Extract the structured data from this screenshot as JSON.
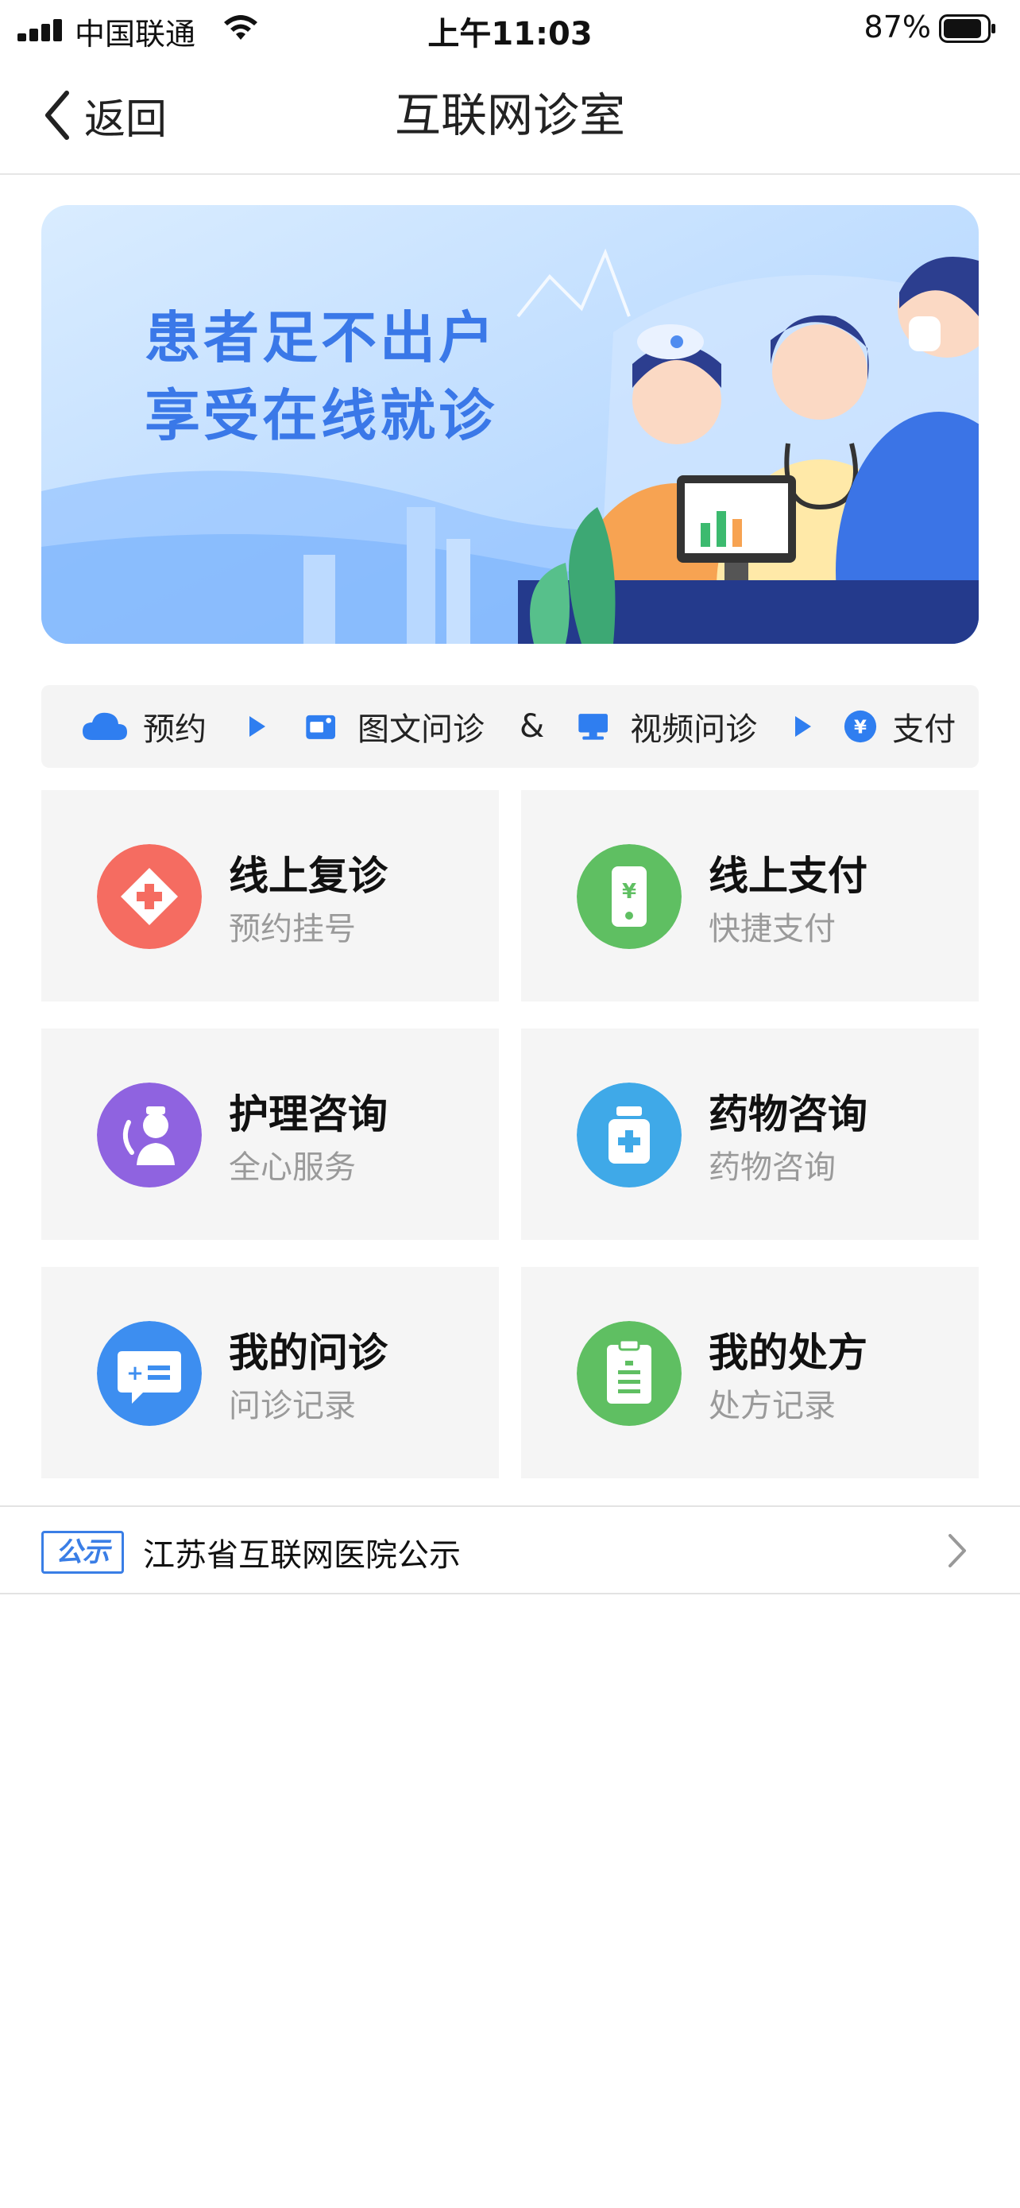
{
  "status_bar": {
    "carrier": "中国联通",
    "time": "上午11:03",
    "battery": "87%",
    "signal_level": 1.0,
    "battery_level": 0.87
  },
  "nav": {
    "back_label": "返回",
    "title": "互联网诊室"
  },
  "banner": {
    "line1": "患者足不出户",
    "line2": "享受在线就诊"
  },
  "process": {
    "steps": [
      {
        "label": "预约",
        "icon": "cloud-icon"
      },
      {
        "label": "图文问诊",
        "icon": "image-chat-icon"
      },
      {
        "label": "视频问诊",
        "icon": "monitor-icon"
      },
      {
        "label": "支付",
        "icon": "yen-coin-icon"
      }
    ],
    "ampersand": "&"
  },
  "services": [
    {
      "title": "线上复诊",
      "subtitle": "预约挂号",
      "icon": "medical-cross-icon",
      "color": "#f56c61"
    },
    {
      "title": "线上支付",
      "subtitle": "快捷支付",
      "icon": "mobile-pay-icon",
      "color": "#5fbf62"
    },
    {
      "title": "护理咨询",
      "subtitle": "全心服务",
      "icon": "nurse-icon",
      "color": "#8f63e0"
    },
    {
      "title": "药物咨询",
      "subtitle": "药物咨询",
      "icon": "medicine-bottle-icon",
      "color": "#3fa9e8"
    },
    {
      "title": "我的问诊",
      "subtitle": "问诊记录",
      "icon": "chat-record-icon",
      "color": "#3d8ef0"
    },
    {
      "title": "我的处方",
      "subtitle": "处方记录",
      "icon": "prescription-icon",
      "color": "#5fbf62"
    }
  ],
  "notice": {
    "badge": "公示",
    "text": "江苏省互联网医院公示"
  },
  "colors": {
    "accent": "#3a78e8",
    "card_bg": "#f5f5f5"
  }
}
